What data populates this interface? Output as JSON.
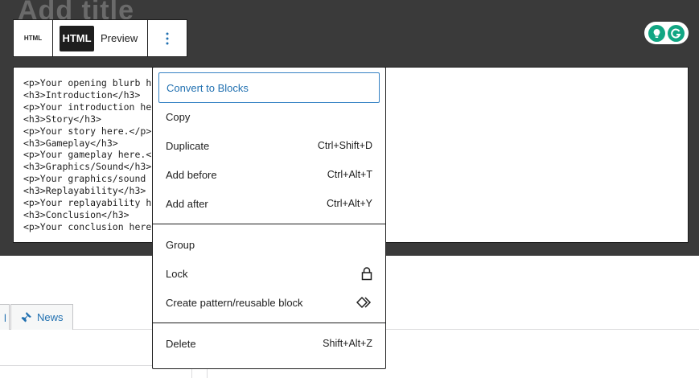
{
  "editor": {
    "faded_title": "Add title",
    "code_lines": [
      "<p>Your opening blurb h",
      "<h3>Introduction</h3>",
      "<p>Your introduction he",
      "<h3>Story</h3>",
      "<p>Your story here.</p>",
      "<h3>Gameplay</h3>",
      "<p>Your gameplay here.<",
      "<h3>Graphics/Sound</h3>",
      "<p>Your graphics/sound",
      "<h3>Replayability</h3>",
      "<p>Your replayability h",
      "<h3>Conclusion</h3>",
      "<p>Your conclusion here"
    ]
  },
  "toolbar": {
    "block_icon_label": "HTML",
    "html_tab": "HTML",
    "preview_tab": "Preview",
    "more_icon": "vertical-ellipsis-icon"
  },
  "grammarly": {
    "icons": [
      "lightbulb-icon",
      "grammarly-g-icon"
    ],
    "color": "#11a683"
  },
  "tabs": {
    "partial_label": "l",
    "news_label": "News",
    "news_icon": "pushpin-icon"
  },
  "menu": {
    "group1": [
      {
        "label": "Convert to Blocks",
        "shortcut": ""
      },
      {
        "label": "Copy",
        "shortcut": ""
      },
      {
        "label": "Duplicate",
        "shortcut": "Ctrl+Shift+D"
      },
      {
        "label": "Add before",
        "shortcut": "Ctrl+Alt+T"
      },
      {
        "label": "Add after",
        "shortcut": "Ctrl+Alt+Y"
      }
    ],
    "group2": [
      {
        "label": "Group",
        "shortcut": ""
      },
      {
        "label": "Lock",
        "icon": "lock-icon"
      },
      {
        "label": "Create pattern/reusable block",
        "icon": "reusable-block-icon"
      }
    ],
    "group3": [
      {
        "label": "Delete",
        "shortcut": "Shift+Alt+Z"
      }
    ]
  },
  "colors": {
    "dark_band": "#3a3a3a",
    "accent": "#2271b1",
    "focus": "#3582c4"
  }
}
